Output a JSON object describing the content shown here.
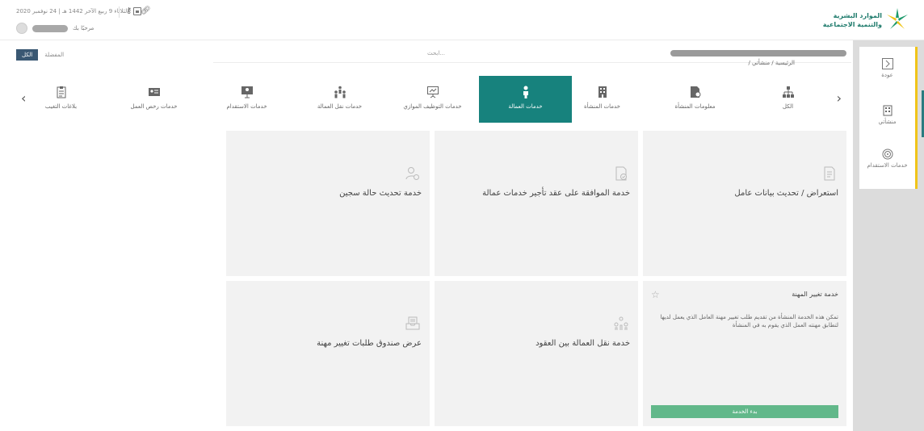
{
  "header": {
    "logo_text_line1": "الموارد البشرية",
    "logo_text_line2": "والتنمية الاجتماعية",
    "date": "الثلاثاء 9 ربيع الآخر 1442 هـ | 24 نوفمبر 2020",
    "greeting": "مرحبًا بك"
  },
  "filter": {
    "all": "الكل",
    "favorites": "المفضلة"
  },
  "search": {
    "placeholder": "ابحث..."
  },
  "breadcrumb": "الرئيسية / منشأتي /",
  "rail": {
    "back": "عودة",
    "my_establishment": "منشأتي",
    "recruitment": "خدمات الاستقدام"
  },
  "tabs": [
    {
      "label": "الكل",
      "icon": "org-chart-icon"
    },
    {
      "label": "معلومات المنشأة",
      "icon": "document-search-icon"
    },
    {
      "label": "خدمات المنشأة",
      "icon": "building-icon"
    },
    {
      "label": "خدمات العمالة",
      "icon": "worker-icon",
      "active": true
    },
    {
      "label": "خدمات التوظيف الموازي",
      "icon": "presentation-icon"
    },
    {
      "label": "خدمات نقل العمالة",
      "icon": "people-transfer-icon"
    },
    {
      "label": "خدمات الاستقدام",
      "icon": "id-screen-icon"
    },
    {
      "label": "خدمات رخص العمل",
      "icon": "id-card-icon"
    },
    {
      "label": "بلاغات التغيب",
      "icon": "clipboard-icon"
    }
  ],
  "cards": [
    {
      "title": "استعراض / تحديث بيانات عامل",
      "icon": "document-icon"
    },
    {
      "title": "خدمة الموافقة على عقد تأجير خدمات عمالة",
      "icon": "document-check-icon"
    },
    {
      "title": "خدمة تحديث حالة سجين",
      "icon": "user-settings-icon"
    },
    {
      "title": "خدمة تغيير المهنة",
      "desc": "تمكن هذه الخدمة المنشأة من تقديم طلب تغيير مهنة العامل الذي يعمل لديها لتطابق مهنته العمل الذي يقوم به في المنشأة",
      "button": "بدء الخدمة"
    },
    {
      "title": "خدمة نقل العمالة بين العقود",
      "icon": "transfer-icon"
    },
    {
      "title": "عرض صندوق طلبات تغيير مهنة",
      "icon": "inbox-icon"
    }
  ],
  "colors": {
    "accent": "#17827d",
    "filter_active": "#3a5873",
    "rail_highlight": "#f0c419",
    "start_button": "#62b88a"
  }
}
